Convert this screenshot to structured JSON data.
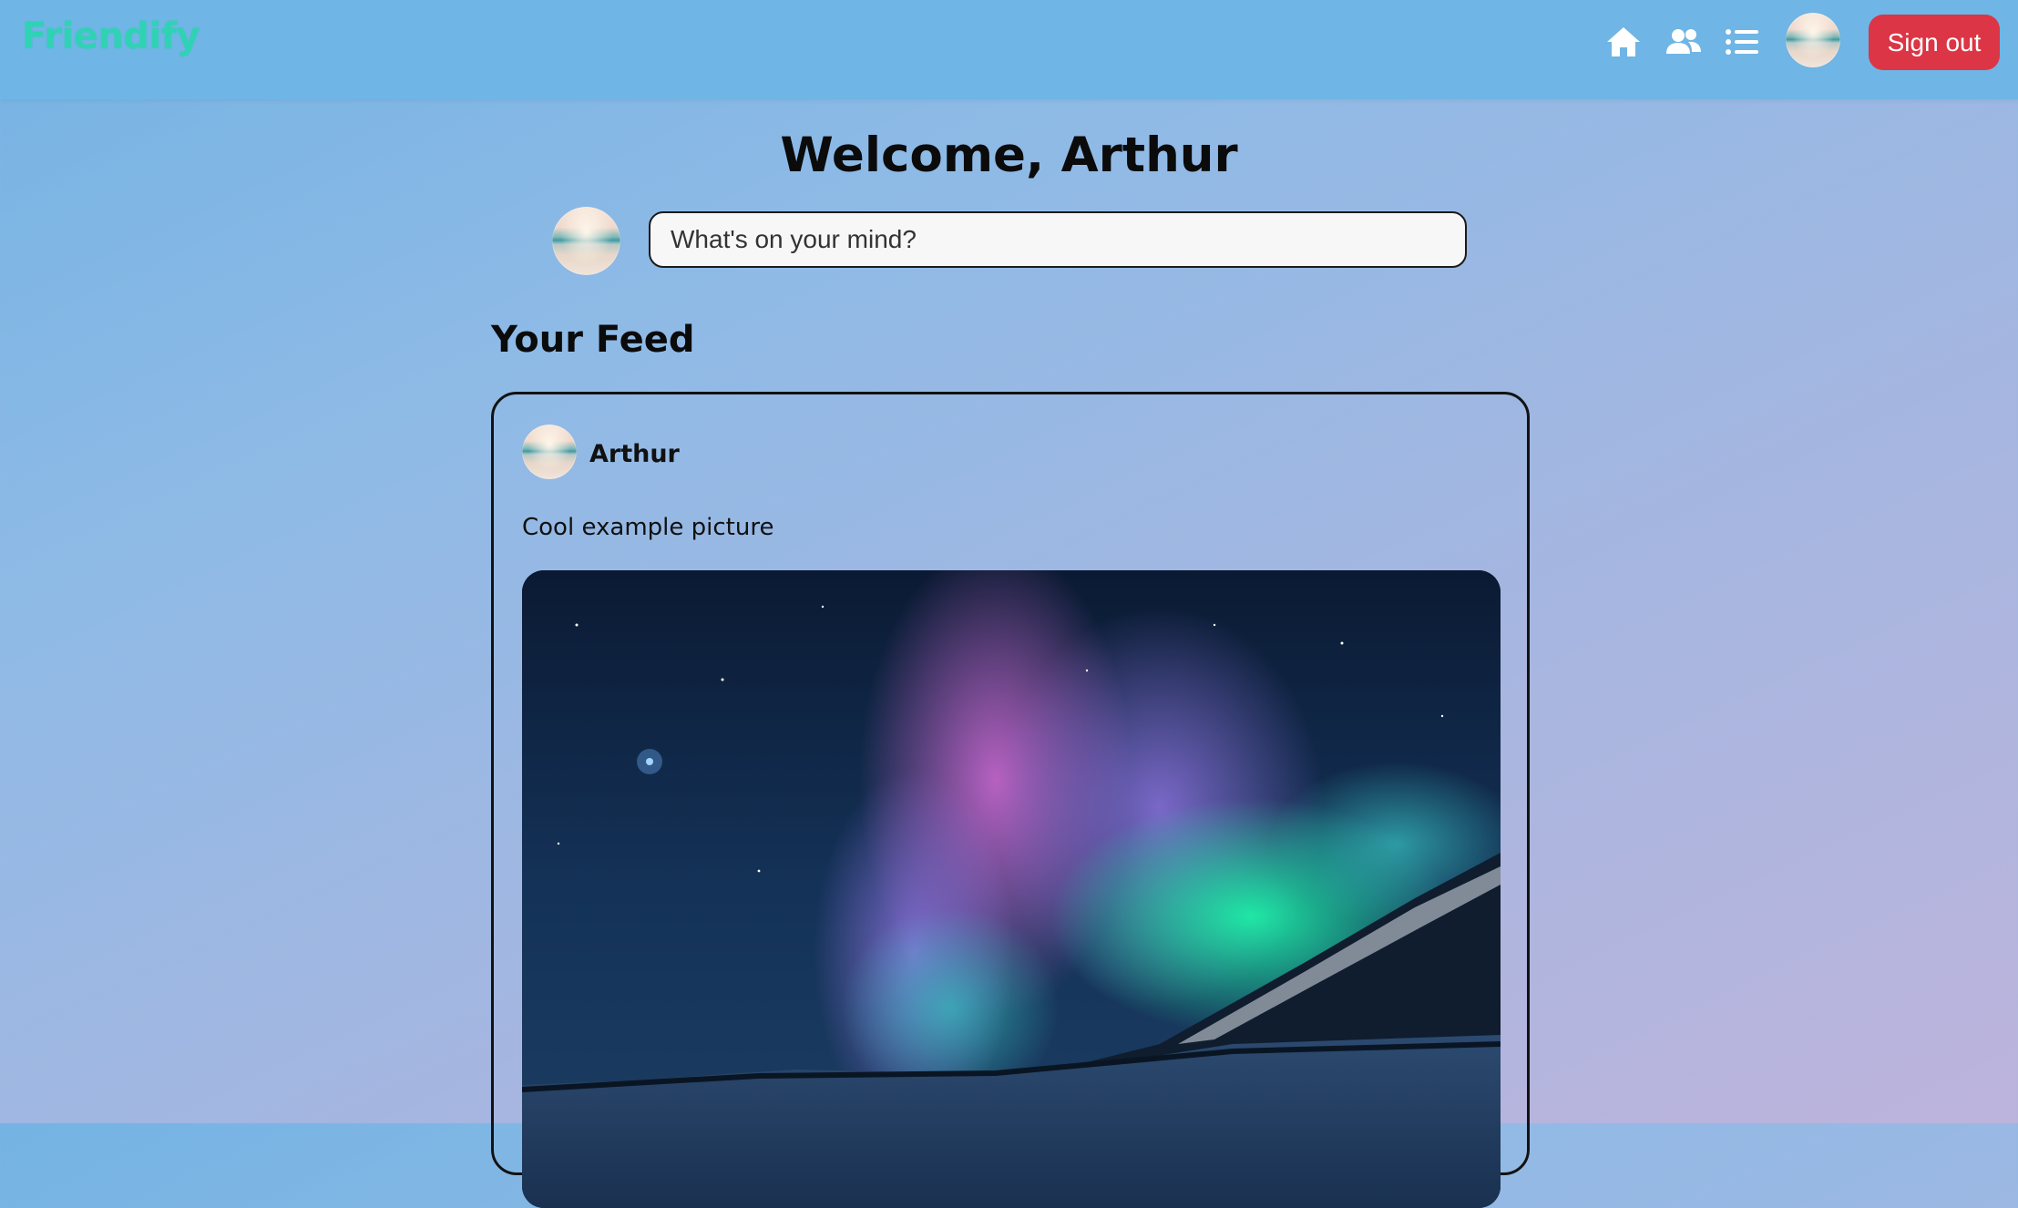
{
  "app": {
    "brand": "Friendify"
  },
  "nav": {
    "icons": [
      "home-icon",
      "friends-icon",
      "list-icon"
    ],
    "signout_label": "Sign out"
  },
  "main": {
    "welcome": "Welcome, Arthur",
    "composer_placeholder": "What's on your mind?",
    "feed_title": "Your Feed"
  },
  "feed": {
    "posts": [
      {
        "author": "Arthur",
        "text": "Cool example picture",
        "image_description": "aurora-night-sky"
      }
    ]
  },
  "colors": {
    "brand": "#2fd3b4",
    "navbar": "#6fb5e5",
    "signout": "#dc3545"
  }
}
